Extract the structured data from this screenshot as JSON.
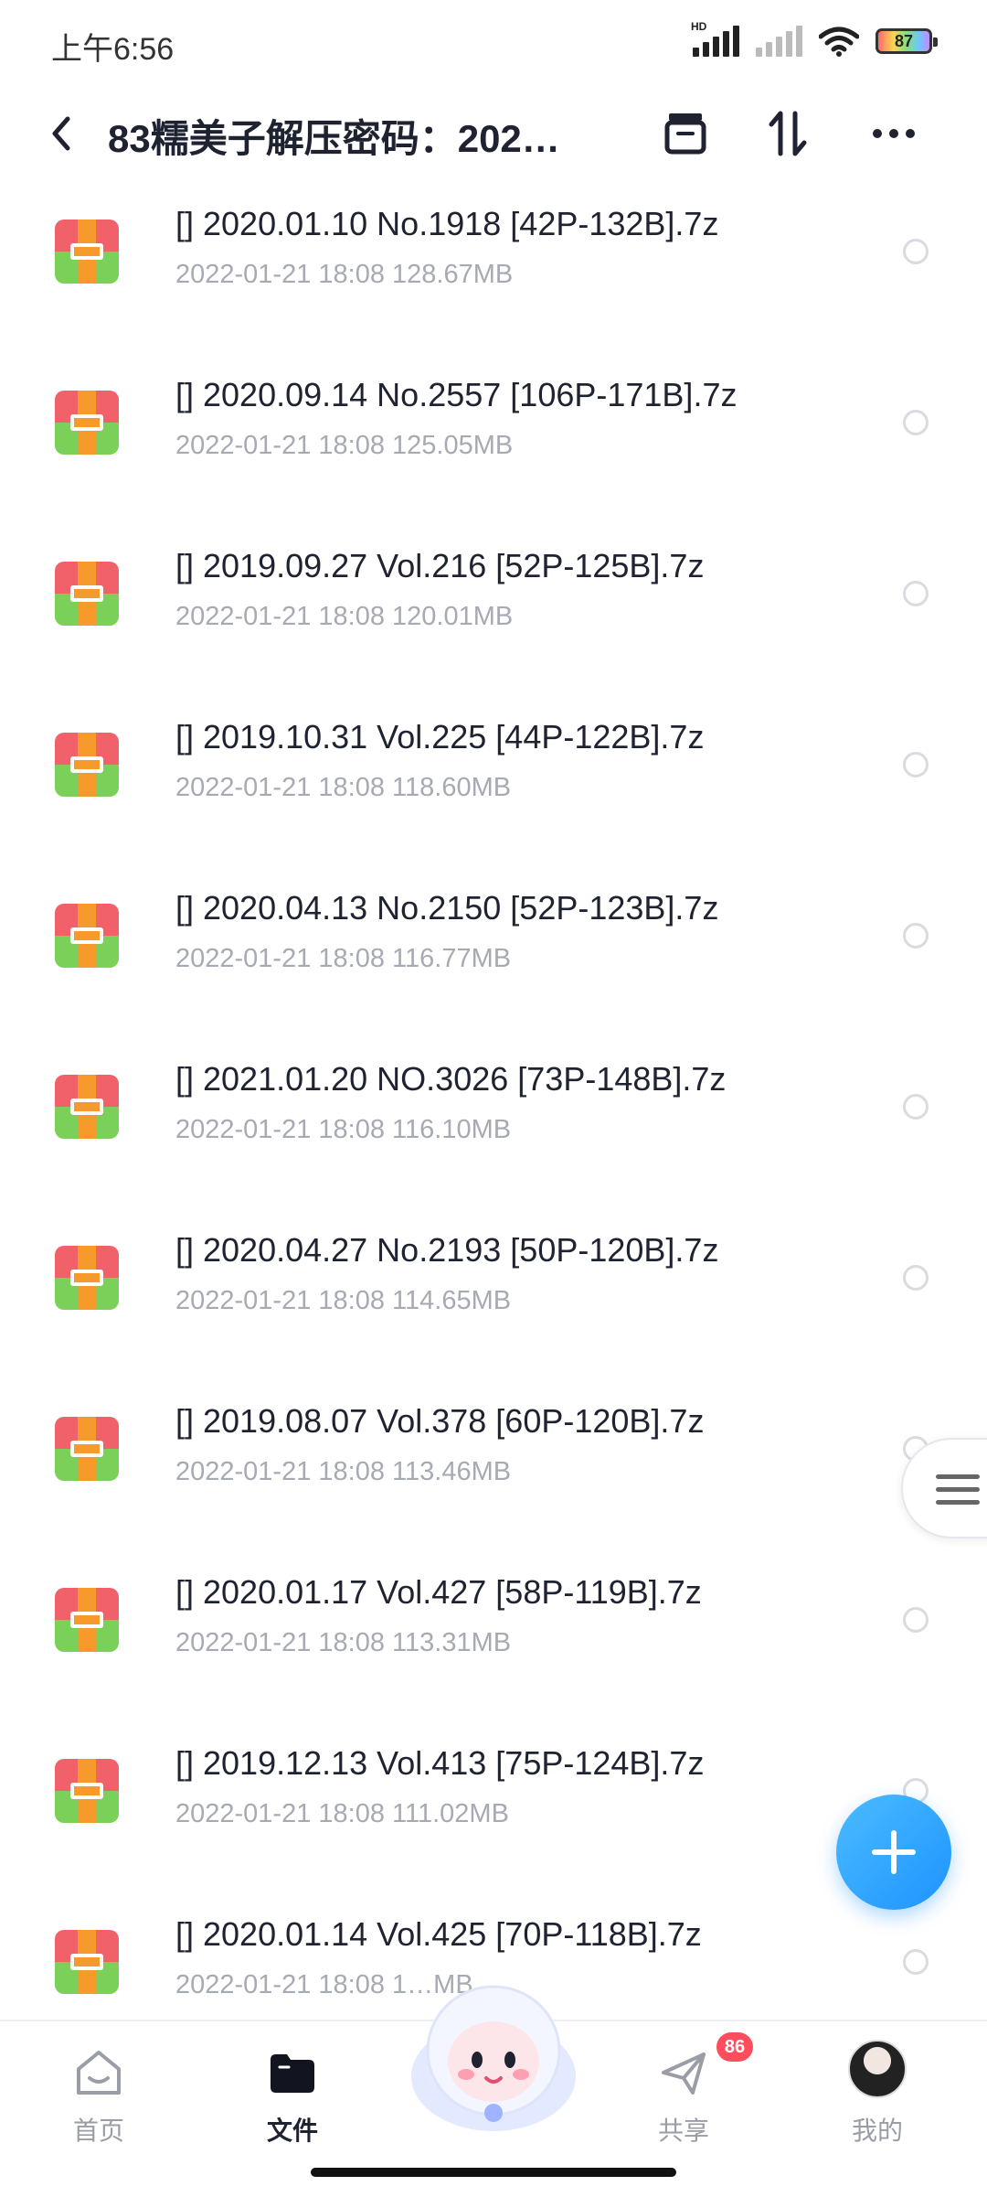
{
  "status": {
    "time": "上午6:56",
    "network_label": "HD",
    "battery": "87"
  },
  "header": {
    "title": "83糯美子解压密码：202…"
  },
  "files": [
    {
      "name": "[] 2020.01.10 No.1918   [42P-132B].7z",
      "meta": "2022-01-21  18:08   128.67MB"
    },
    {
      "name": "[] 2020.09.14 No.2557   [106P-171B].7z",
      "meta": "2022-01-21  18:08   125.05MB"
    },
    {
      "name": "[] 2019.09.27 Vol.216   [52P-125B].7z",
      "meta": "2022-01-21  18:08   120.01MB"
    },
    {
      "name": "[] 2019.10.31 Vol.225   [44P-122B].7z",
      "meta": "2022-01-21  18:08   118.60MB"
    },
    {
      "name": "[] 2020.04.13 No.2150   [52P-123B].7z",
      "meta": "2022-01-21  18:08   116.77MB"
    },
    {
      "name": "[] 2021.01.20 NO.3026   [73P-148B].7z",
      "meta": "2022-01-21  18:08   116.10MB"
    },
    {
      "name": "[] 2020.04.27 No.2193   [50P-120B].7z",
      "meta": "2022-01-21  18:08   114.65MB"
    },
    {
      "name": "[] 2019.08.07 Vol.378   [60P-120B].7z",
      "meta": "2022-01-21  18:08   113.46MB"
    },
    {
      "name": "[] 2020.01.17 Vol.427   [58P-119B].7z",
      "meta": "2022-01-21  18:08   113.31MB"
    },
    {
      "name": "[] 2019.12.13 Vol.413   [75P-124B].7z",
      "meta": "2022-01-21  18:08   111.02MB"
    },
    {
      "name": "[] 2020.01.14 Vol.425   [70P-118B].7z",
      "meta": "2022-01-21  18:08   1…MB"
    }
  ],
  "nav": {
    "home": "首页",
    "files": "文件",
    "share": "共享",
    "share_badge": "86",
    "mine": "我的"
  },
  "icons": {
    "back": "chevron-left-icon",
    "header_1": "archive-box-icon",
    "header_2": "sort-icon",
    "header_3": "more-icon",
    "file": "zip-archive-icon",
    "fab": "plus-icon"
  },
  "colors": {
    "accent": "#1e93ff",
    "badge": "#ff4d5e",
    "meta_text": "#a7aab3"
  }
}
